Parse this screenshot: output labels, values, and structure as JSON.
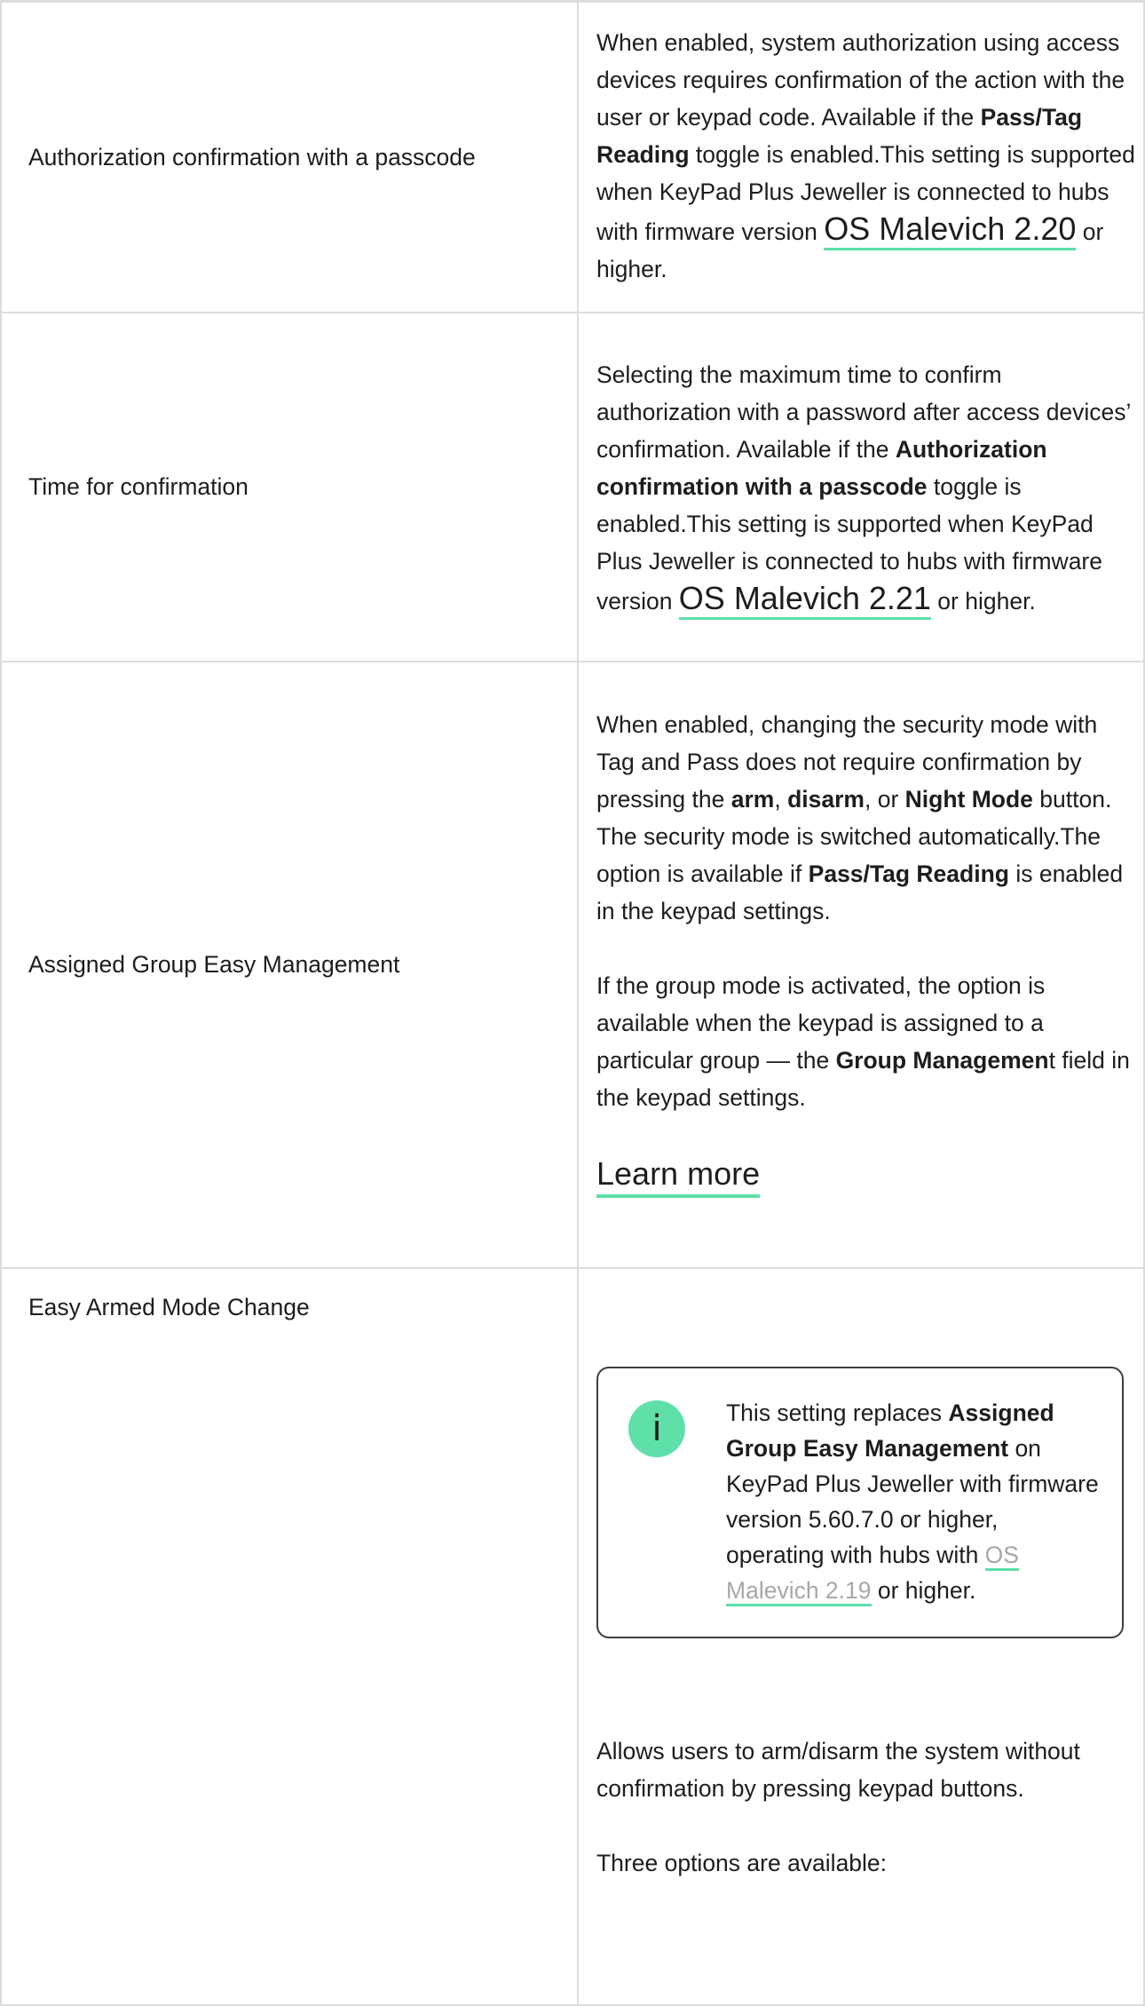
{
  "rows": [
    {
      "name": "Authorization confirmation with a passcode",
      "desc": {
        "t1": "When enabled, system authorization using access devices requires confirmation of the action with the user or keypad code. Available if the ",
        "b1": "Pass/Tag Reading",
        "t2": " toggle is enabled.This setting is supported when KeyPad Plus Jeweller is connected to hubs with firmware version ",
        "link": "OS Malevich 2.20",
        "t3": " or higher."
      }
    },
    {
      "name": "Time for confirmation",
      "desc": {
        "t1": "Selecting the maximum time to confirm authorization with a password after access devices’ confirmation. Available if the ",
        "b1": "Authorization confirmation with a passcode",
        "t2": " toggle is enabled.This setting is supported when KeyPad Plus Jeweller is connected to hubs with firmware version ",
        "link": "OS Malevich 2.21",
        "t3": " or higher."
      }
    },
    {
      "name": "Assigned Group Easy Management",
      "desc": {
        "p1_t1": "When enabled, changing the security mode with Tag and Pass does not require confirmation by pressing the ",
        "p1_b1": "arm",
        "p1_t2": ", ",
        "p1_b2": "disarm",
        "p1_t3": ", or ",
        "p1_b3": "Night Mode",
        "p1_t4": " button. The security mode is switched automatically.The option is available if ",
        "p1_b4": "Pass/Tag Reading",
        "p1_t5": " is enabled in the keypad settings.",
        "p2_t1": "If the group mode is activated, the option is available when the keypad is assigned to a particular group — the ",
        "p2_b1": "Group Managemen",
        "p2_t2": "t field in the keypad settings.",
        "learn_more": "Learn more"
      }
    },
    {
      "name": "Easy Armed Mode Change",
      "info": {
        "icon": "i",
        "t1": "This setting replaces ",
        "b1": "Assigned Group Easy Management",
        "t2": " on KeyPad Plus Jeweller with firmware version 5.60.7.0 or higher, operating with hubs with ",
        "link": "OS Malevich 2.19",
        "t3": " or higher."
      },
      "p1": "Allows users to arm/disarm the system without confirmation by pressing keypad buttons.",
      "p2": "Three options are available:"
    }
  ],
  "colors": {
    "accent": "#5ee0a8",
    "border": "#dcdcdc",
    "text": "#1d1d1d",
    "muted_link": "#a8a8a8"
  }
}
